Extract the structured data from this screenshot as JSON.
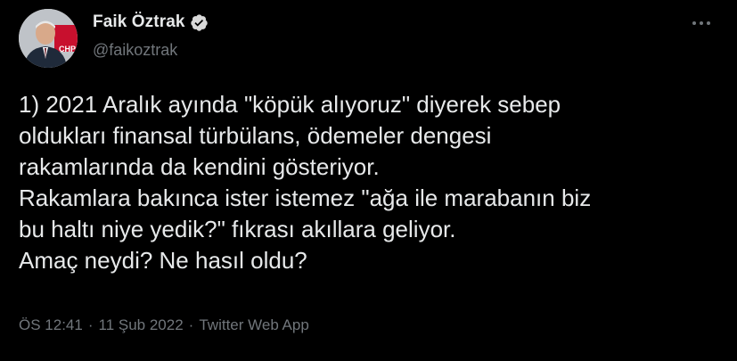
{
  "tweet": {
    "display_name": "Faik Öztrak",
    "handle": "@faikoztrak",
    "verified_icon": "verified-badge-icon",
    "more_icon": "more-options-icon",
    "text_lines": [
      "1) 2021 Aralık ayında \"köpük alıyoruz\" diyerek sebep",
      "oldukları finansal türbülans, ödemeler dengesi",
      "rakamlarında da kendini gösteriyor.",
      "Rakamlara bakınca ister istemez \"ağa ile marabanın biz",
      "bu haltı niye yedik?\" fıkrası akıllara geliyor.",
      "Amaç neydi? Ne hasıl oldu?"
    ],
    "time": "ÖS 12:41",
    "separator": "·",
    "date": "11 Şub 2022",
    "source": "Twitter Web App"
  },
  "colors": {
    "background": "#000000",
    "primary_text": "#e7e9ea",
    "secondary_text": "#71767b",
    "verified": "#d9d9d9"
  }
}
